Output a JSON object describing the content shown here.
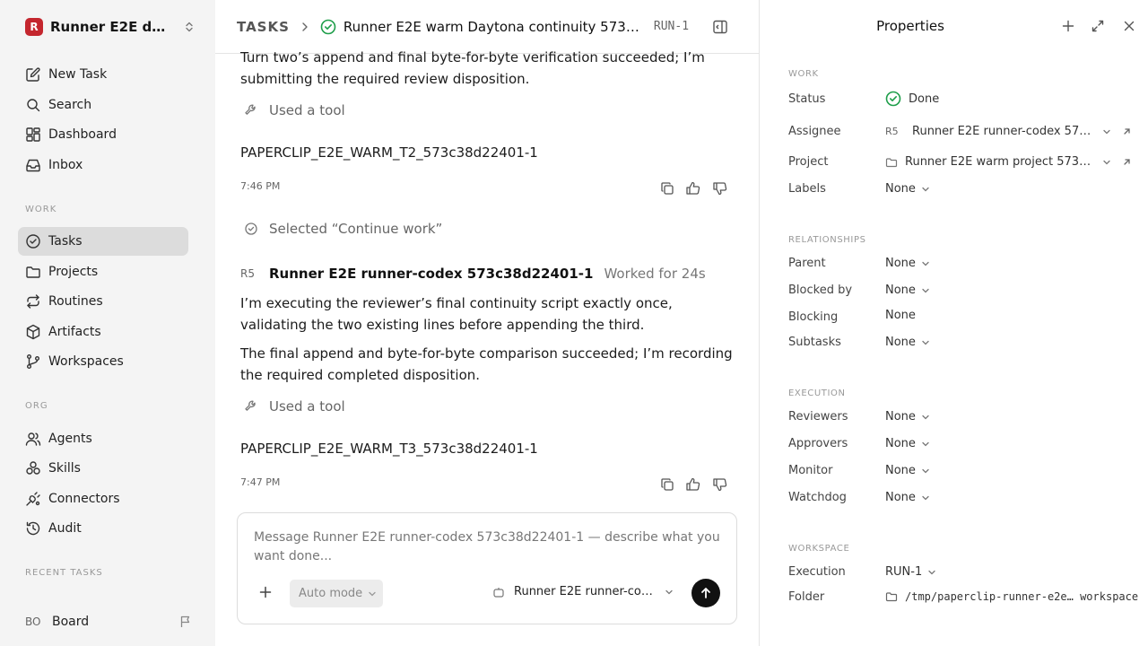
{
  "sidebar": {
    "workspace_logo": "R",
    "workspace_name": "Runner E2E da...",
    "nav_primary": [
      {
        "label": "New Task",
        "icon": "edit-icon"
      },
      {
        "label": "Search",
        "icon": "search-icon"
      },
      {
        "label": "Dashboard",
        "icon": "dashboard-icon"
      },
      {
        "label": "Inbox",
        "icon": "inbox-icon"
      }
    ],
    "section_work": "WORK",
    "nav_work": [
      {
        "label": "Tasks",
        "icon": "check-circle-icon",
        "active": true
      },
      {
        "label": "Projects",
        "icon": "folder-icon"
      },
      {
        "label": "Routines",
        "icon": "repeat-icon"
      },
      {
        "label": "Artifacts",
        "icon": "box-icon"
      },
      {
        "label": "Workspaces",
        "icon": "branch-icon"
      }
    ],
    "section_org": "ORG",
    "nav_org": [
      {
        "label": "Agents",
        "icon": "users-icon"
      },
      {
        "label": "Skills",
        "icon": "skills-icon"
      },
      {
        "label": "Connectors",
        "icon": "plug-icon"
      },
      {
        "label": "Audit",
        "icon": "history-icon"
      }
    ],
    "section_recent": "RECENT TASKS",
    "board_avatar": "BO",
    "board_label": "Board"
  },
  "header": {
    "breadcrumb": "TASKS",
    "title": "Runner E2E warm Daytona continuity 573c38...",
    "task_id": "RUN-1"
  },
  "feed": {
    "para_top": "Turn two’s append and final byte-for-byte verification succeeded; I’m submitting the required review disposition.",
    "tool_1": "Used a tool",
    "code_1": "PAPERCLIP_E2E_WARM_T2_573c38d22401-1",
    "time_1": "7:46 PM",
    "selected": "Selected “Continue work”",
    "author_avatar": "R5",
    "author_name": "Runner E2E runner-codex 573c38d22401-1",
    "author_duration": "Worked for 24s",
    "para_2": "I’m executing the reviewer’s final continuity script exactly once, validating the two existing lines before appending the third.",
    "para_3": "The final append and byte-for-byte comparison succeeded; I’m recording the required completed disposition.",
    "tool_2": "Used a tool",
    "code_2": "PAPERCLIP_E2E_WARM_T3_573c38d22401-1",
    "time_2": "7:47 PM"
  },
  "composer": {
    "placeholder": "Message Runner E2E runner-codex 573c38d22401-1 — describe what you want done...",
    "mode": "Auto mode",
    "agent": "Runner E2E runner-code..."
  },
  "properties": {
    "title": "Properties",
    "work_label": "WORK",
    "status_label": "Status",
    "status_value": "Done",
    "assignee_label": "Assignee",
    "assignee_avatar": "R5",
    "assignee_value": "Runner E2E runner-codex 573c3...",
    "project_label": "Project",
    "project_value": "Runner E2E warm project 573c38...",
    "labels_label": "Labels",
    "labels_value": "None",
    "relationships_label": "RELATIONSHIPS",
    "parent_label": "Parent",
    "parent_value": "None",
    "blocked_by_label": "Blocked by",
    "blocked_by_value": "None",
    "blocking_label": "Blocking",
    "blocking_value": "None",
    "subtasks_label": "Subtasks",
    "subtasks_value": "None",
    "execution_section": "EXECUTION",
    "reviewers_label": "Reviewers",
    "reviewers_value": "None",
    "approvers_label": "Approvers",
    "approvers_value": "None",
    "monitor_label": "Monitor",
    "monitor_value": "None",
    "watchdog_label": "Watchdog",
    "watchdog_value": "None",
    "workspace_section": "WORKSPACE",
    "execution_label": "Execution",
    "execution_value": "RUN-1",
    "folder_label": "Folder",
    "folder_value": "/tmp/paperclip-runner-e2e… workspace"
  },
  "colors": {
    "accent_brand": "#c4262e",
    "status_done": "#1e9e4a",
    "sidebar_bg": "#f4f4f4",
    "active_nav_bg": "#dcdcdc"
  }
}
